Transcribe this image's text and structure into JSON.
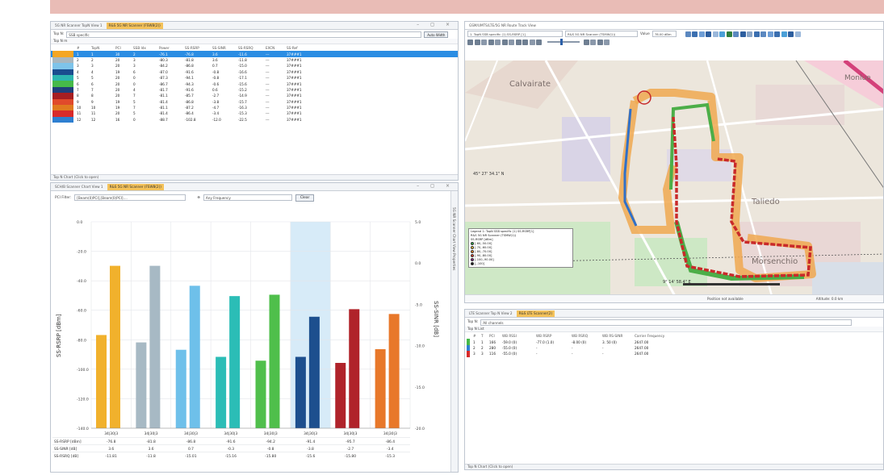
{
  "panel1": {
    "tabs": [
      "5G NR Scanner TopN View 1",
      "R&S 5G NR Scanner (FSW8(2))"
    ],
    "window_controls": "–  ◻  ×",
    "topn_label": "Top N:",
    "topn_value": "SSB specific",
    "auto_width": "Auto Width",
    "sub_header": "Top N m",
    "columns": [
      "#",
      "TopN",
      "PCI",
      "SSB Idx",
      "Power",
      "SS-RSRP",
      "SS-SINR",
      "SS-RSRQ",
      "EXCN",
      "SS-Ref"
    ],
    "rows": [
      {
        "color": "#f5a623",
        "cells": [
          "1",
          "1",
          "30",
          "2",
          "-76.1",
          "-76.8",
          "3.6",
          "-11.6",
          "---",
          "37###1"
        ]
      },
      {
        "color": "#a9b7bf",
        "cells": [
          "2",
          "2",
          "20",
          "3",
          "-80.3",
          "-81.8",
          "3.6",
          "-11.8",
          "---",
          "37###1"
        ]
      },
      {
        "color": "#7ec4ea",
        "cells": [
          "3",
          "3",
          "20",
          "3",
          "-84.2",
          "-86.8",
          "0.7",
          "-15.0",
          "---",
          "37###1"
        ]
      },
      {
        "color": "#1a4d8f",
        "cells": [
          "4",
          "4",
          "19",
          "6",
          "-87.0",
          "-91.6",
          "-0.8",
          "-16.6",
          "---",
          "37###1"
        ]
      },
      {
        "color": "#2cb5b0",
        "cells": [
          "5",
          "5",
          "20",
          "0",
          "-87.3",
          "-94.1",
          "-0.8",
          "-17.1",
          "---",
          "37###1"
        ]
      },
      {
        "color": "#46b949",
        "cells": [
          "6",
          "6",
          "20",
          "0",
          "-86.7",
          "-94.3",
          "-0.6",
          "-15.6",
          "---",
          "37###1"
        ]
      },
      {
        "color": "#1e3f7a",
        "cells": [
          "7",
          "7",
          "20",
          "4",
          "-81.7",
          "-91.6",
          "0.6",
          "-15.2",
          "---",
          "37###1"
        ]
      },
      {
        "color": "#a61e22",
        "cells": [
          "8",
          "8",
          "20",
          "7",
          "-81.1",
          "-85.7",
          "-2.7",
          "-14.9",
          "---",
          "37###1"
        ]
      },
      {
        "color": "#e04a2b",
        "cells": [
          "9",
          "9",
          "19",
          "5",
          "-81.4",
          "-86.8",
          "-3.8",
          "-15.7",
          "---",
          "37###1"
        ]
      },
      {
        "color": "#e07a1f",
        "cells": [
          "10",
          "10",
          "19",
          "7",
          "-81.1",
          "-87.2",
          "-4.7",
          "-16.3",
          "---",
          "37###1"
        ]
      },
      {
        "color": "#d82b2b",
        "cells": [
          "11",
          "11",
          "20",
          "5",
          "-81.4",
          "-86.4",
          "-3.4",
          "-15.3",
          "---",
          "37###1"
        ]
      },
      {
        "color": "#2e7fd1",
        "cells": [
          "12",
          "12",
          "16",
          "0",
          "-88.7",
          "-102.8",
          "-12.0",
          "-22.5",
          "---",
          "37###1"
        ]
      }
    ],
    "status": "Top N Chart (Click to open)"
  },
  "panel2": {
    "tabs": [
      "SCH/B Scanner Chart View 1",
      "R&S 5G NR Scanner (FSW8(2))"
    ],
    "window_controls": "–  ◻  ×",
    "pci_filter_label": "PCI Filter:",
    "pci_filter_value": "[Beam(0)PCI],[Beam(0)PCI]....",
    "freq_label": "Any Frequency",
    "clear_label": "Clear",
    "side_title": "5G NR Scanner Chart View Properties"
  },
  "chart_data": {
    "type": "bar",
    "categories": [
      "34|30|3",
      "34|30|3",
      "34|30|3",
      "34|30|3",
      "34|30|3",
      "34|30|3",
      "34|30|3",
      "34|30|3"
    ],
    "ylabel": "SS-RSRP [dBm]",
    "y2label": "SS-SINR [dB]",
    "ylim": [
      -140,
      0
    ],
    "y2lim": [
      -20,
      10
    ],
    "yticks": [
      "0.0",
      "-20.0",
      "-40.0",
      "-60.0",
      "-80.0",
      "-100.0",
      "-120.0",
      "-140.0"
    ],
    "y2ticks": [
      "5.0",
      "0.0",
      "-5.0",
      "-10.0",
      "-15.0",
      "-20.0"
    ],
    "colors": [
      "#f1b12c",
      "#a7b9c4",
      "#6ec0ea",
      "#2bbdb6",
      "#4fbf4b",
      "#1d4f8e",
      "#b0232a",
      "#e8782a"
    ],
    "series": [
      {
        "name": "SS-RSRP [dBm]",
        "values": [
          -76.8,
          -81.8,
          -86.8,
          -91.6,
          -94.2,
          -91.6,
          -95.7,
          -86.4
        ]
      },
      {
        "name": "SS-SINR [dB]",
        "values": [
          3.6,
          3.6,
          0.7,
          -0.8,
          -0.6,
          -3.8,
          -2.7,
          -3.4
        ]
      }
    ],
    "highlight_index": 5,
    "table_rows": [
      {
        "label": "SS-RSRP [dBm]",
        "values": [
          "-76.8",
          "-81.8",
          "-86.8",
          "-91.6",
          "-94.2",
          "-91.4",
          "-95.7",
          "-86.4"
        ]
      },
      {
        "label": "SS-SINR [dB]",
        "values": [
          "3.6",
          "3.6",
          "0.7",
          "-0.3",
          "-0.8",
          "-3.8",
          "-2.7",
          "-3.4"
        ]
      },
      {
        "label": "SS-RSRQ [dB]",
        "values": [
          "-11.81",
          "-11.8",
          "-15.01",
          "-15.16",
          "-15.80",
          "-15.6",
          "-15.80",
          "-15.3"
        ]
      }
    ]
  },
  "panel3": {
    "title": "GSM/UMTS/LTE/5G NR Route Track View",
    "toolbar": {
      "dropdown1": "1. TopN SSB specific (1) SS-RSRP [1]",
      "dropdown2": "R&S 5G NR Scanner (TSMW(1))",
      "value_label": "Value",
      "value_input": "78.00 dBm"
    },
    "map_labels": {
      "calvairate": "Calvairate",
      "monluee": "Monlue",
      "taliedo": "Taliedo",
      "morsenchio": "Morsenchio",
      "coord": "45° 27' 34.1\" N",
      "coord2": "9° 14' 58.4\" E"
    },
    "legend": {
      "title": "Legend 1: TopN SSB specific (1) SS-RSRP[1]",
      "subtitle": "R&S 5G NR Scanner (TSMW(1))",
      "unit": "SS-RSRP [dBm]",
      "items": [
        {
          "color": "#2bb34a",
          "label": "[-60,-50.00]"
        },
        {
          "color": "#f4c339",
          "label": "[-70,-60.00]"
        },
        {
          "color": "#f08a24",
          "label": "[-80,-70.00]"
        },
        {
          "color": "#e6402c",
          "label": "[-90,-80.00]"
        },
        {
          "color": "#8a1a8a",
          "label": "[-100,-90.00]"
        },
        {
          "color": "#1c1c1c",
          "label": "[,-100]"
        }
      ]
    },
    "status_left": "Position not available",
    "status_right": "Altitude: 0.0 km"
  },
  "panel4": {
    "tabs": [
      "LTE Scanner Top N View 2",
      "R&S LTE Scanner(2)"
    ],
    "topn_label": "Top N:",
    "topn_value": "All channels",
    "sub_header": "Top N List",
    "columns": [
      "#",
      "T",
      "PCI",
      "WB RSSI",
      "WB RSRP",
      "WB RSRQ",
      "WB RS-SINR",
      "Carrier Frequency"
    ],
    "rows": [
      {
        "color": "#46b949",
        "cells": [
          "1",
          "1",
          "166",
          "-59.0 (0)",
          "-77.0 (1.0)",
          "-8.00 (0)",
          "3. 50 (0)",
          "2647.00"
        ]
      },
      {
        "color": "#2e7fd1",
        "cells": [
          "2",
          "2",
          "280",
          "-55.0 (0)",
          "-",
          "-",
          "-",
          "2647.00"
        ]
      },
      {
        "color": "#d82b2b",
        "cells": [
          "3",
          "3",
          "116",
          "-55.0 (0)",
          "-",
          "-",
          "-",
          "2647.00"
        ]
      }
    ],
    "status": "Top N Chart (Click to open)"
  }
}
